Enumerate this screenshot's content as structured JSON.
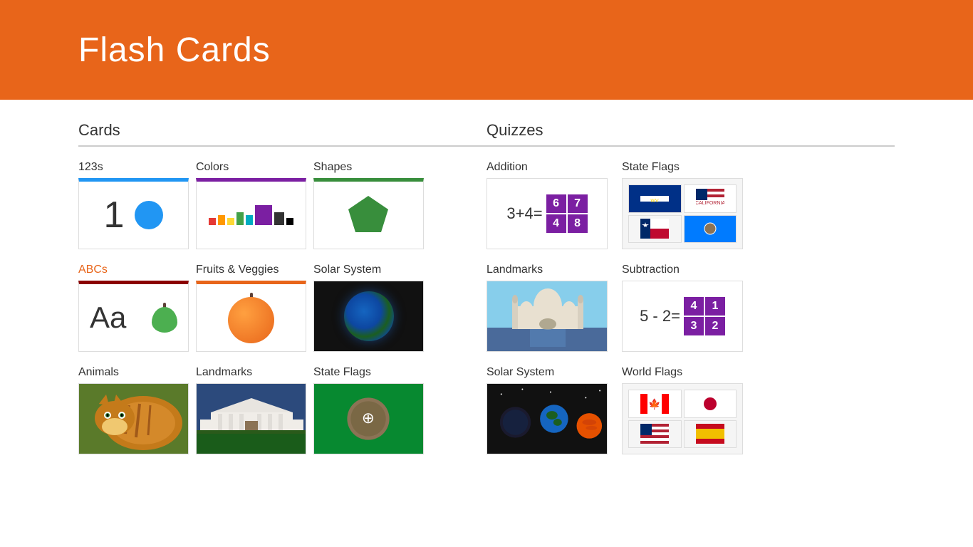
{
  "header": {
    "title": "Flash Cards",
    "bg_color": "#E8651A"
  },
  "cards_section": {
    "title": "Cards",
    "items": [
      {
        "id": "123s",
        "label": "123s",
        "orange": false
      },
      {
        "id": "colors",
        "label": "Colors",
        "orange": false
      },
      {
        "id": "shapes",
        "label": "Shapes",
        "orange": false
      },
      {
        "id": "abcs",
        "label": "ABCs",
        "orange": true
      },
      {
        "id": "fruits",
        "label": "Fruits & Veggies",
        "orange": false
      },
      {
        "id": "solar-system",
        "label": "Solar System",
        "orange": false
      },
      {
        "id": "animals",
        "label": "Animals",
        "orange": false
      },
      {
        "id": "landmarks",
        "label": "Landmarks",
        "orange": false
      },
      {
        "id": "state-flags",
        "label": "State Flags",
        "orange": false
      }
    ]
  },
  "quizzes_section": {
    "title": "Quizzes",
    "items": [
      {
        "id": "addition",
        "label": "Addition",
        "orange": false
      },
      {
        "id": "state-flags-quiz",
        "label": "State Flags",
        "orange": false
      },
      {
        "id": "landmarks-quiz",
        "label": "Landmarks",
        "orange": false
      },
      {
        "id": "subtraction",
        "label": "Subtraction",
        "orange": false
      },
      {
        "id": "solar-system-quiz",
        "label": "Solar System",
        "orange": false
      },
      {
        "id": "world-flags",
        "label": "World Flags",
        "orange": false
      }
    ]
  }
}
